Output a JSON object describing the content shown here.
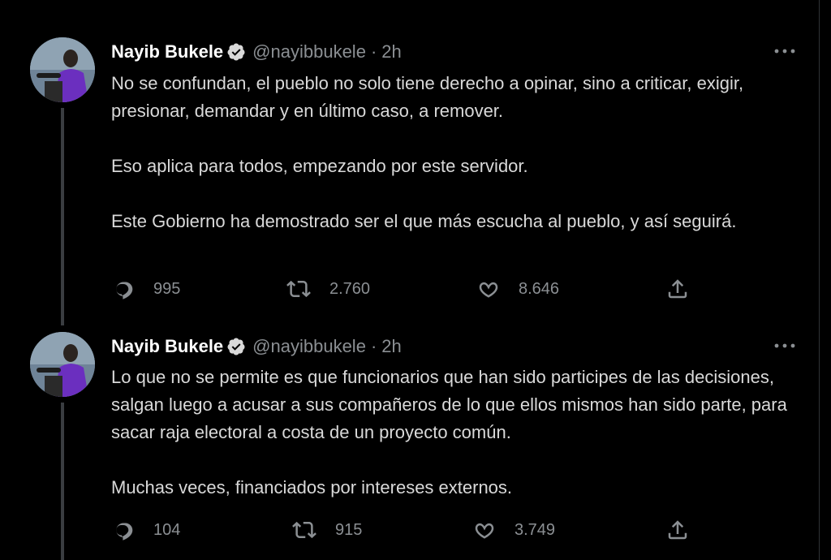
{
  "tweets": [
    {
      "author": {
        "name": "Nayib Bukele",
        "handle": "@nayibbukele",
        "separator": "·",
        "time": "2h"
      },
      "paragraphs": [
        "No se confundan, el pueblo no solo tiene derecho a opinar, sino a criticar, exigir, presionar, demandar y en último caso, a remover.",
        "Eso aplica para todos, empezando por este servidor.",
        "Este Gobierno ha demostrado ser el que más escucha al pueblo, y así seguirá."
      ],
      "stats": {
        "replies": "995",
        "retweets": "2.760",
        "likes": "8.646"
      }
    },
    {
      "author": {
        "name": "Nayib Bukele",
        "handle": "@nayibbukele",
        "separator": "·",
        "time": "2h"
      },
      "paragraphs": [
        "Lo que no se permite es que funcionarios que han sido participes de las decisiones, salgan luego a acusar a sus compañeros de lo que ellos mismos han sido parte, para sacar raja electoral a costa de un proyecto común.",
        "Muchas veces, financiados por intereses externos."
      ],
      "stats": {
        "replies": "104",
        "retweets": "915",
        "likes": "3.749"
      }
    }
  ],
  "icons": {
    "verified": "verified-badge-icon",
    "more": "more-options-icon",
    "reply": "reply-icon",
    "retweet": "retweet-icon",
    "like": "like-icon",
    "share": "share-icon"
  },
  "colors": {
    "background": "#000000",
    "text": "#d9d9d9",
    "name": "#ffffff",
    "muted": "#8b8f93",
    "thread_line": "#3a3d41"
  }
}
